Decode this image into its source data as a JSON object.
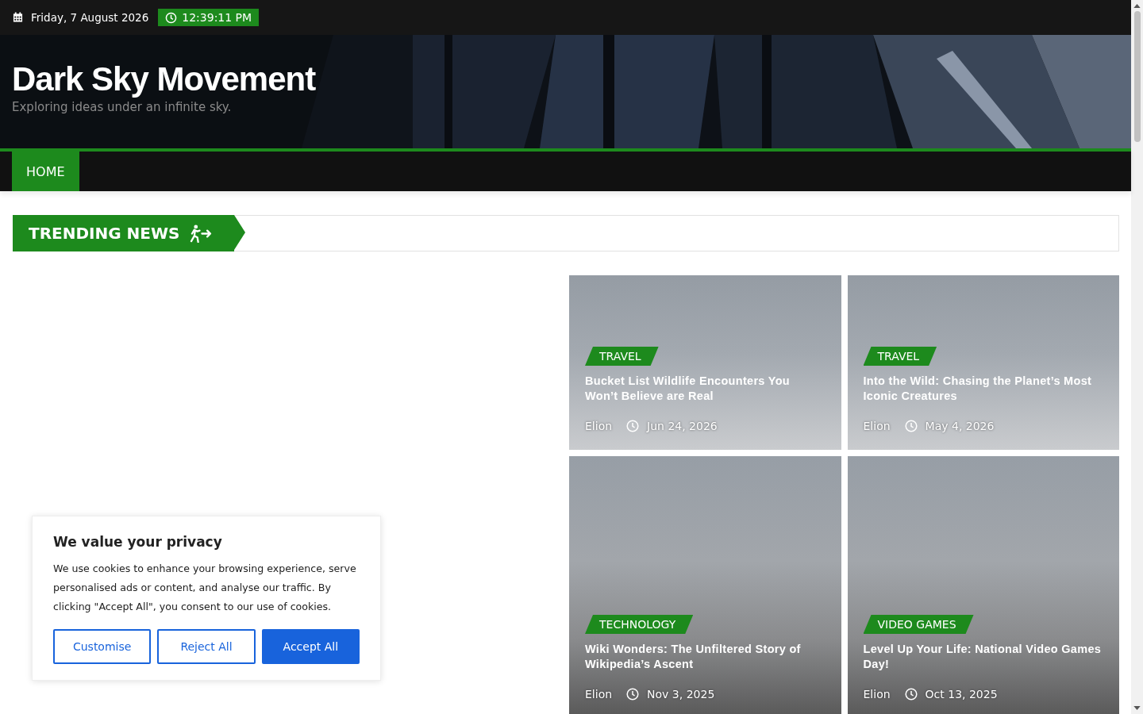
{
  "top_bar": {
    "date": "Friday, 7 August 2026",
    "time": "12:39:11 PM"
  },
  "header": {
    "site_title": "Dark Sky Movement",
    "tagline": "Exploring ideas under an infinite sky."
  },
  "nav": [
    {
      "label": "HOME",
      "selected": true
    }
  ],
  "trending": {
    "label": "TRENDING NEWS"
  },
  "posts": [
    {
      "category": "TRAVEL",
      "title": "Bucket List Wildlife Encounters You Won’t Believe are Real",
      "author": "Elion",
      "date": "Jun 24, 2026"
    },
    {
      "category": "TRAVEL",
      "title": "Into the Wild: Chasing the Planet’s Most Iconic Creatures",
      "author": "Elion",
      "date": "May 4, 2026"
    },
    {
      "category": "TECHNOLOGY",
      "title": "Wiki Wonders: The Unfiltered Story of Wikipedia’s Ascent",
      "author": "Elion",
      "date": "Nov 3, 2025"
    },
    {
      "category": "VIDEO GAMES",
      "title": "Level Up Your Life: National Video Games Day!",
      "author": "Elion",
      "date": "Oct 13, 2025"
    }
  ],
  "cookie_banner": {
    "title": "We value your privacy",
    "text": "We use cookies to enhance your browsing experience, serve personalised ads or content, and analyse our traffic. By clicking \"Accept All\", you consent to our use of cookies.",
    "buttons": [
      {
        "label": "Customise",
        "kind": "outline"
      },
      {
        "label": "Reject All",
        "kind": "outline"
      },
      {
        "label": "Accept All",
        "kind": "primary"
      }
    ]
  }
}
